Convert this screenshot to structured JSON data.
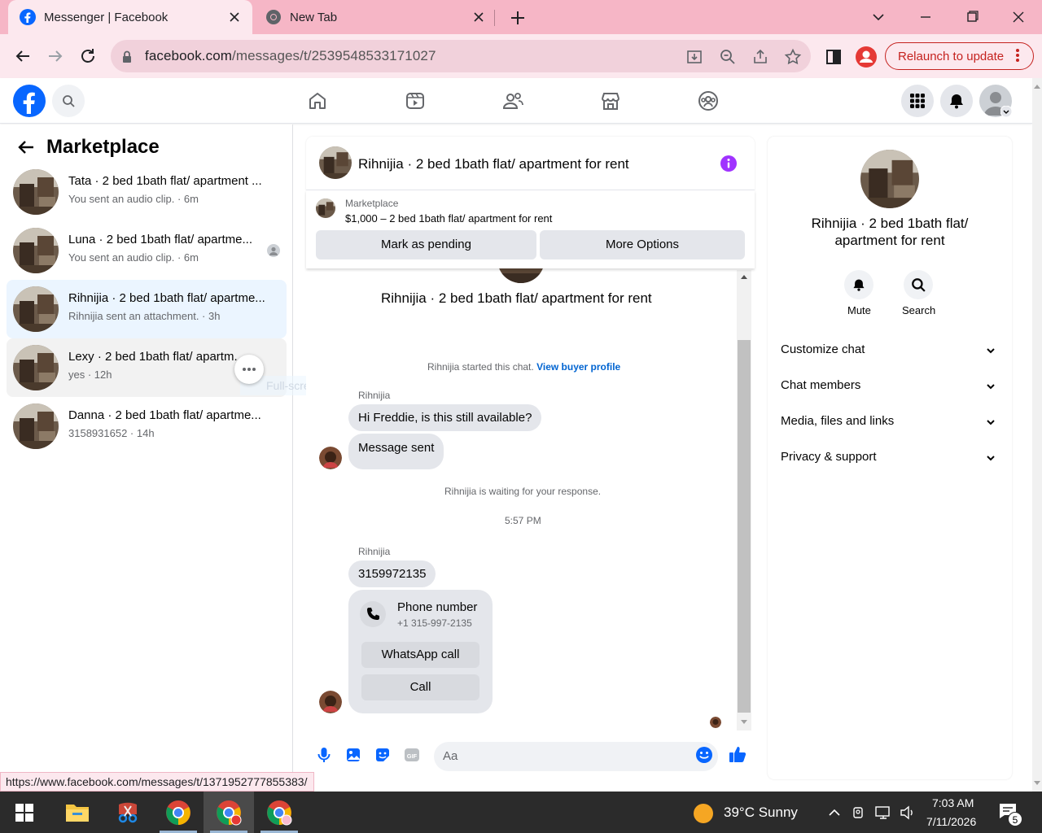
{
  "browser": {
    "tabs": [
      {
        "title": "Messenger | Facebook",
        "active": true
      },
      {
        "title": "New Tab",
        "active": false
      }
    ],
    "url_host": "facebook.com",
    "url_path": "/messages/t/2539548533171027",
    "relaunch_label": "Relaunch to update",
    "status_url": "https://www.facebook.com/messages/t/1371952777855383/"
  },
  "sidebar": {
    "title": "Marketplace",
    "conversations": [
      {
        "name": "Tata · 2 bed 1bath flat/ apartment ...",
        "snippet": "You sent an audio clip. · 6m"
      },
      {
        "name": "Luna · 2 bed 1bath flat/ apartme...",
        "snippet": "You sent an audio clip. · 6m"
      },
      {
        "name": "Rihnijia · 2 bed 1bath flat/ apartme...",
        "snippet": "Rihnijia sent an attachment. · 3h"
      },
      {
        "name": "Lexy · 2 bed 1bath flat/ apartm...",
        "snippet": "yes · 12h"
      },
      {
        "name": "Danna · 2 bed 1bath flat/ apartme...",
        "snippet": "3158931652 · 14h"
      }
    ],
    "snip_label": "Full-screen Snip"
  },
  "chat": {
    "title": "Rihnijia · 2 bed 1bath flat/ apartment for rent",
    "marketplace_label": "Marketplace",
    "listing": "$1,000 – 2 bed 1bath flat/ apartment for rent",
    "mark_pending": "Mark as pending",
    "more_options": "More Options",
    "intro_title": "Rihnijia · 2 bed 1bath flat/ apartment for rent",
    "started": "Rihnijia started this chat.",
    "view_profile": "View buyer profile",
    "sender": "Rihnijia",
    "msg1": "Hi Freddie, is this still available?",
    "msg2": "Message sent",
    "waiting": "Rihnijia is waiting for your response.",
    "time": "5:57 PM",
    "sender2": "Rihnijia",
    "msg3": "3159972135",
    "phone_title": "Phone number",
    "phone_value": "+1 315-997-2135",
    "whatsapp": "WhatsApp call",
    "call": "Call",
    "composer_placeholder": "Aa"
  },
  "info": {
    "name": "Rihnijia · 2 bed 1bath flat/ apartment for rent",
    "mute": "Mute",
    "search": "Search",
    "sections": [
      "Customize chat",
      "Chat members",
      "Media, files and links",
      "Privacy & support"
    ]
  },
  "taskbar": {
    "weather": "39°C  Sunny",
    "time": "7:03 AM",
    "date": "7/11/2026",
    "notifications": "5"
  },
  "colors": {
    "fb_blue": "#0866ff",
    "purple": "#a033ff",
    "tab_bar": "#f6b6c6",
    "toolbar": "#fce8ee"
  }
}
